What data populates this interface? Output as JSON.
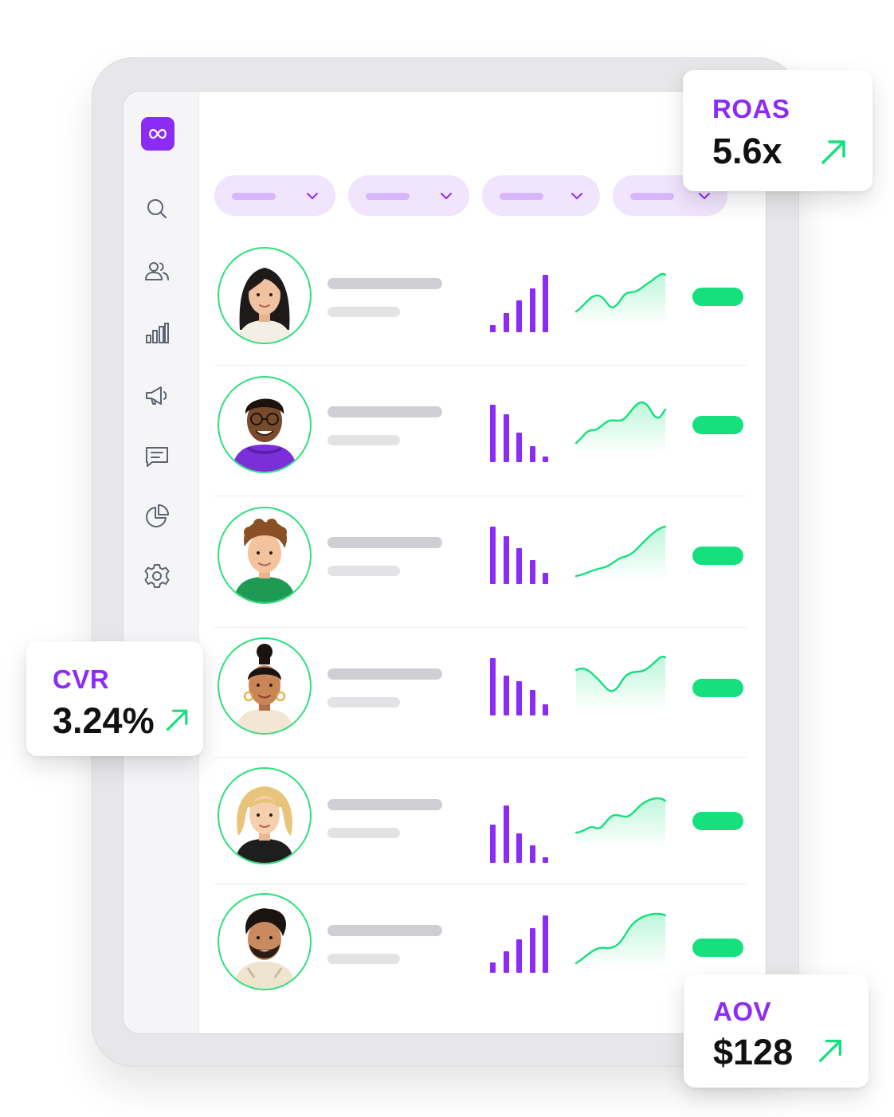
{
  "app": {
    "nav": [
      {
        "id": "search",
        "icon": "search-icon"
      },
      {
        "id": "audience",
        "icon": "users-icon"
      },
      {
        "id": "analytics",
        "icon": "bar-chart-icon"
      },
      {
        "id": "campaigns",
        "icon": "megaphone-icon"
      },
      {
        "id": "messages",
        "icon": "message-icon"
      },
      {
        "id": "reports",
        "icon": "pie-chart-icon"
      },
      {
        "id": "settings",
        "icon": "gear-icon"
      }
    ],
    "logo_icon": "infinity-icon",
    "filter_count": 4,
    "rows": [
      {
        "avatar": "avatar-woman-long-black-hair",
        "bars": [
          0.12,
          0.34,
          0.56,
          0.76,
          1.0
        ],
        "trend": "up",
        "status": "active"
      },
      {
        "avatar": "avatar-man-glasses-purple-hoodie",
        "bars": [
          1.0,
          0.84,
          0.52,
          0.28,
          0.1
        ],
        "trend": "up",
        "status": "active"
      },
      {
        "avatar": "avatar-man-curly-hair-green-shirt",
        "bars": [
          1.0,
          0.84,
          0.62,
          0.42,
          0.2
        ],
        "trend": "up",
        "status": "active"
      },
      {
        "avatar": "avatar-woman-hair-bun",
        "bars": [
          1.0,
          0.7,
          0.6,
          0.44,
          0.2
        ],
        "trend": "dip-then-up",
        "status": "active"
      },
      {
        "avatar": "avatar-woman-blonde-bob",
        "bars": [
          0.66,
          1.0,
          0.52,
          0.3,
          0.1
        ],
        "trend": "up",
        "status": "active"
      },
      {
        "avatar": "avatar-man-beard-hoodie",
        "bars": [
          0.18,
          0.38,
          0.58,
          0.78,
          1.0
        ],
        "trend": "up",
        "status": "active"
      }
    ]
  },
  "kpis": {
    "roas": {
      "label": "ROAS",
      "value": "5.6x",
      "trend_icon": "arrow-up-right-icon"
    },
    "cvr": {
      "label": "CVR",
      "value": "3.24%",
      "trend_icon": "arrow-up-right-icon"
    },
    "aov": {
      "label": "AOV",
      "value": "$128",
      "trend_icon": "arrow-up-right-icon"
    }
  },
  "colors": {
    "accent": "#8B2CF5",
    "accent_soft": "#F1E4FD",
    "positive": "#16E07D",
    "text": "#111111"
  }
}
